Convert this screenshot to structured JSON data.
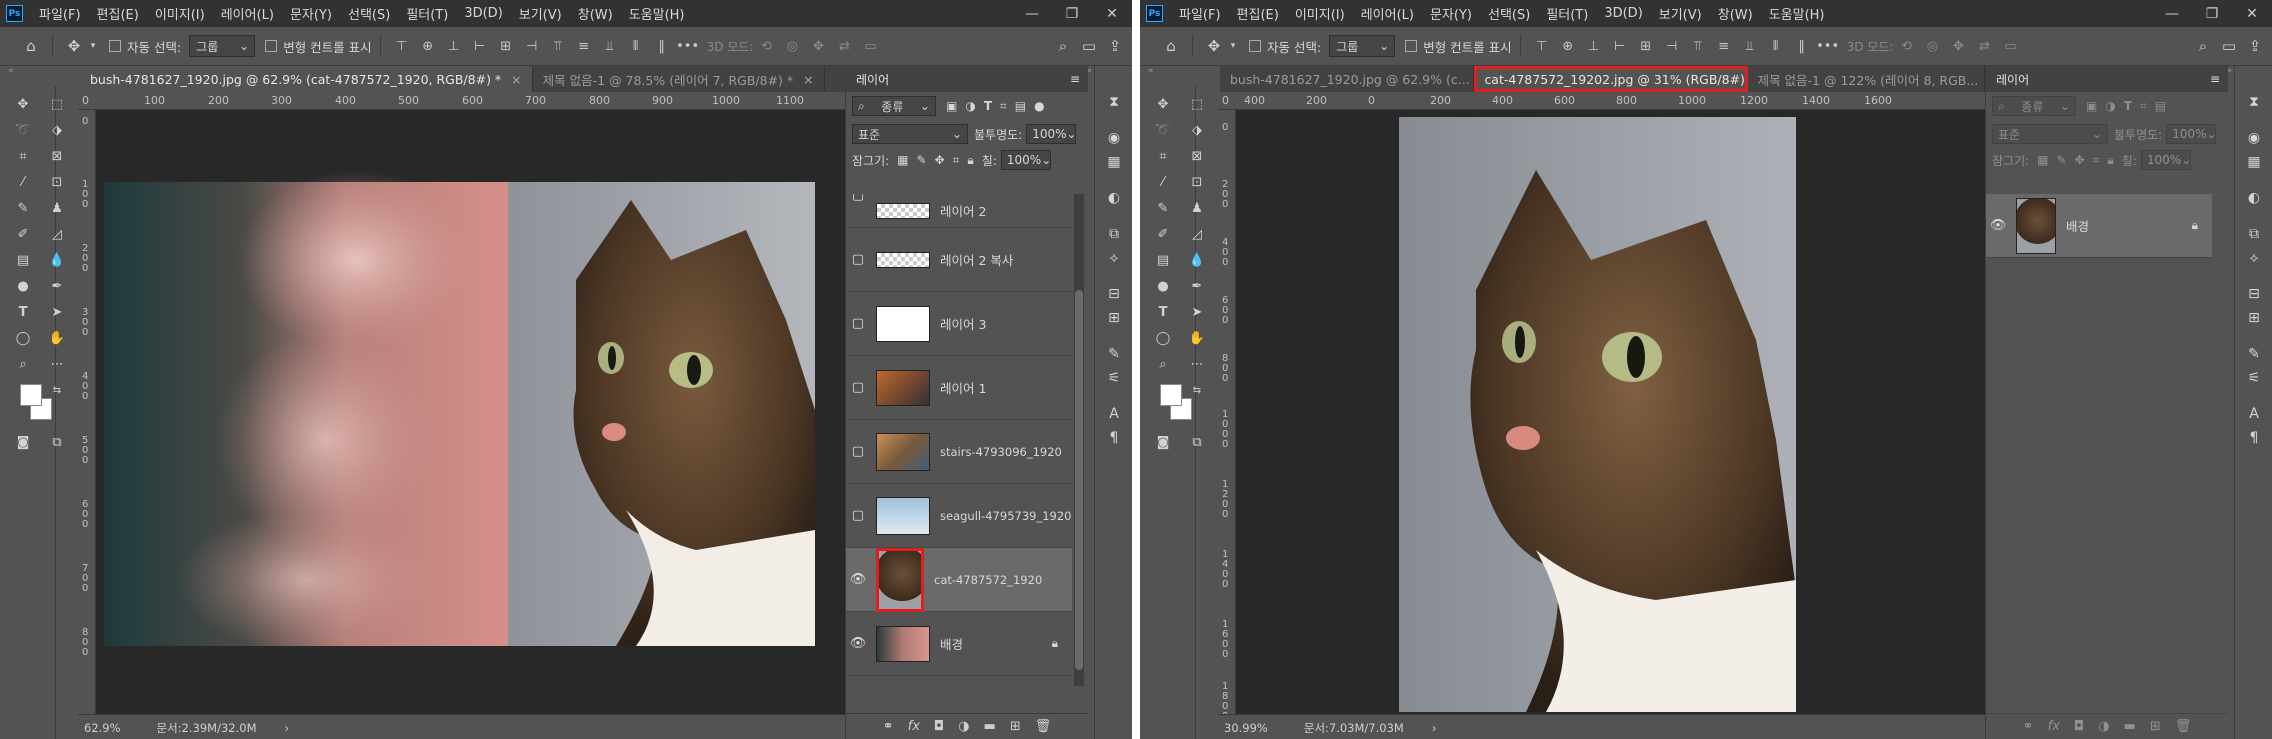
{
  "menu": {
    "items": [
      "파일(F)",
      "편집(E)",
      "이미지(I)",
      "레이어(L)",
      "문자(Y)",
      "선택(S)",
      "필터(T)",
      "3D(D)",
      "보기(V)",
      "창(W)",
      "도움말(H)"
    ],
    "logo": "Ps"
  },
  "options": {
    "auto_select_label": "자동 선택:",
    "auto_select_value": "그룹",
    "transform_label": "변형 컨트롤 표시",
    "mode_3d_label": "3D 모드:",
    "more": "•••"
  },
  "left": {
    "tabs": [
      {
        "label": "bush-4781627_1920.jpg @ 62.9% (cat-4787572_1920, RGB/8#) *",
        "active": true
      },
      {
        "label": "제목 없음-1 @ 78.5% (레이어 7, RGB/8#) *",
        "active": false
      }
    ],
    "ruler_h": [
      "0",
      "100",
      "200",
      "300",
      "400",
      "500",
      "600",
      "700",
      "800",
      "900",
      "1000",
      "1100"
    ],
    "ruler_v": [
      "0",
      "1 0 0",
      "2 0 0",
      "3 0 0",
      "4 0 0",
      "5 0 0",
      "6 0 0",
      "7 0 0",
      "8 0 0"
    ],
    "zoom": "62.9%",
    "doc_info": "문서:2.39M/32.0M",
    "layers_panel": {
      "title": "레이어",
      "filter_label": "종류",
      "blend_mode": "표준",
      "opacity_label": "불투명도:",
      "opacity_value": "100%",
      "lock_label": "잠그기:",
      "fill_label": "칠:",
      "fill_value": "100%",
      "layers": [
        {
          "name": "레이어 2",
          "visible": false,
          "thumb": "checker",
          "selected": false
        },
        {
          "name": "레이어 2 복사",
          "visible": false,
          "thumb": "checker",
          "selected": false
        },
        {
          "name": "레이어 3",
          "visible": false,
          "thumb": "white",
          "selected": false
        },
        {
          "name": "레이어 1",
          "visible": false,
          "thumb": "orange",
          "selected": false
        },
        {
          "name": "stairs-4793096_1920",
          "visible": false,
          "thumb": "stairs",
          "selected": false
        },
        {
          "name": "seagull-4795739_1920",
          "visible": false,
          "thumb": "seagull",
          "selected": false
        },
        {
          "name": "cat-4787572_1920",
          "visible": true,
          "thumb": "cat",
          "selected": true
        },
        {
          "name": "배경",
          "visible": true,
          "thumb": "bush",
          "selected": false,
          "locked": true
        }
      ]
    }
  },
  "right": {
    "tabs": [
      {
        "label": "bush-4781627_1920.jpg @ 62.9% (c...",
        "active": false
      },
      {
        "label": "cat-4787572_19202.jpg @ 31% (RGB/8#)",
        "active": true
      },
      {
        "label": "제목 없음-1 @ 122% (레이어 8, RGB...",
        "active": false
      }
    ],
    "ruler_h": [
      "0",
      "400",
      "200",
      "0",
      "200",
      "400",
      "600",
      "800",
      "1000",
      "1200",
      "1400",
      "1600"
    ],
    "ruler_v": [
      "0",
      "2 0 0",
      "4 0 0",
      "6 0 0",
      "8 0 0",
      "1 0 0 0",
      "1 2 0 0",
      "1 4 0 0",
      "1 6 0 0",
      "1 8 0 0"
    ],
    "zoom": "30.99%",
    "doc_info": "문서:7.03M/7.03M",
    "layers_panel": {
      "title": "레이어",
      "filter_label": "종류",
      "blend_mode": "표준",
      "opacity_label": "불투명도:",
      "opacity_value": "100%",
      "lock_label": "잠그기:",
      "fill_label": "칠:",
      "fill_value": "100%",
      "layers": [
        {
          "name": "배경",
          "visible": true,
          "thumb": "cat",
          "selected": true,
          "locked": true
        }
      ]
    }
  },
  "colors": {
    "highlight": "#e02020",
    "app_bg": "#535353",
    "canvas_bg": "#282828"
  }
}
